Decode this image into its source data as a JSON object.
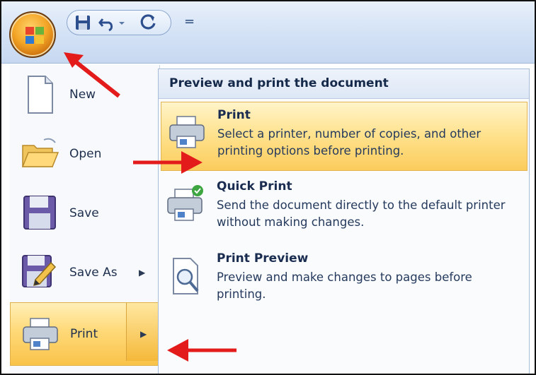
{
  "quick_access": {
    "save_icon": "save-icon",
    "undo_icon": "undo-icon",
    "redo_icon": "redo-icon",
    "customize_glyph": "="
  },
  "office_button": {
    "icon": "office-logo-icon"
  },
  "left_menu": {
    "items": [
      {
        "label": "New",
        "icon": "new-document-icon",
        "has_submenu": false
      },
      {
        "label": "Open",
        "icon": "open-folder-icon",
        "has_submenu": false
      },
      {
        "label": "Save",
        "icon": "save-disk-icon",
        "has_submenu": false
      },
      {
        "label": "Save As",
        "icon": "save-as-icon",
        "has_submenu": true
      },
      {
        "label": "Print",
        "icon": "printer-icon",
        "has_submenu": true,
        "selected": true
      }
    ]
  },
  "submenu": {
    "title": "Preview and print the document",
    "options": [
      {
        "title": "Print",
        "description": "Select a printer, number of copies, and other printing options before printing.",
        "icon": "printer-icon",
        "highlighted": true
      },
      {
        "title": "Quick Print",
        "description": "Send the document directly to the default printer without making changes.",
        "icon": "quick-print-icon"
      },
      {
        "title": "Print Preview",
        "description": "Preview and make changes to pages before printing.",
        "icon": "print-preview-icon"
      }
    ]
  },
  "colors": {
    "annotation_arrow": "#e31b1b",
    "highlight": "#ffd978",
    "menu_text": "#1e2f4d"
  }
}
